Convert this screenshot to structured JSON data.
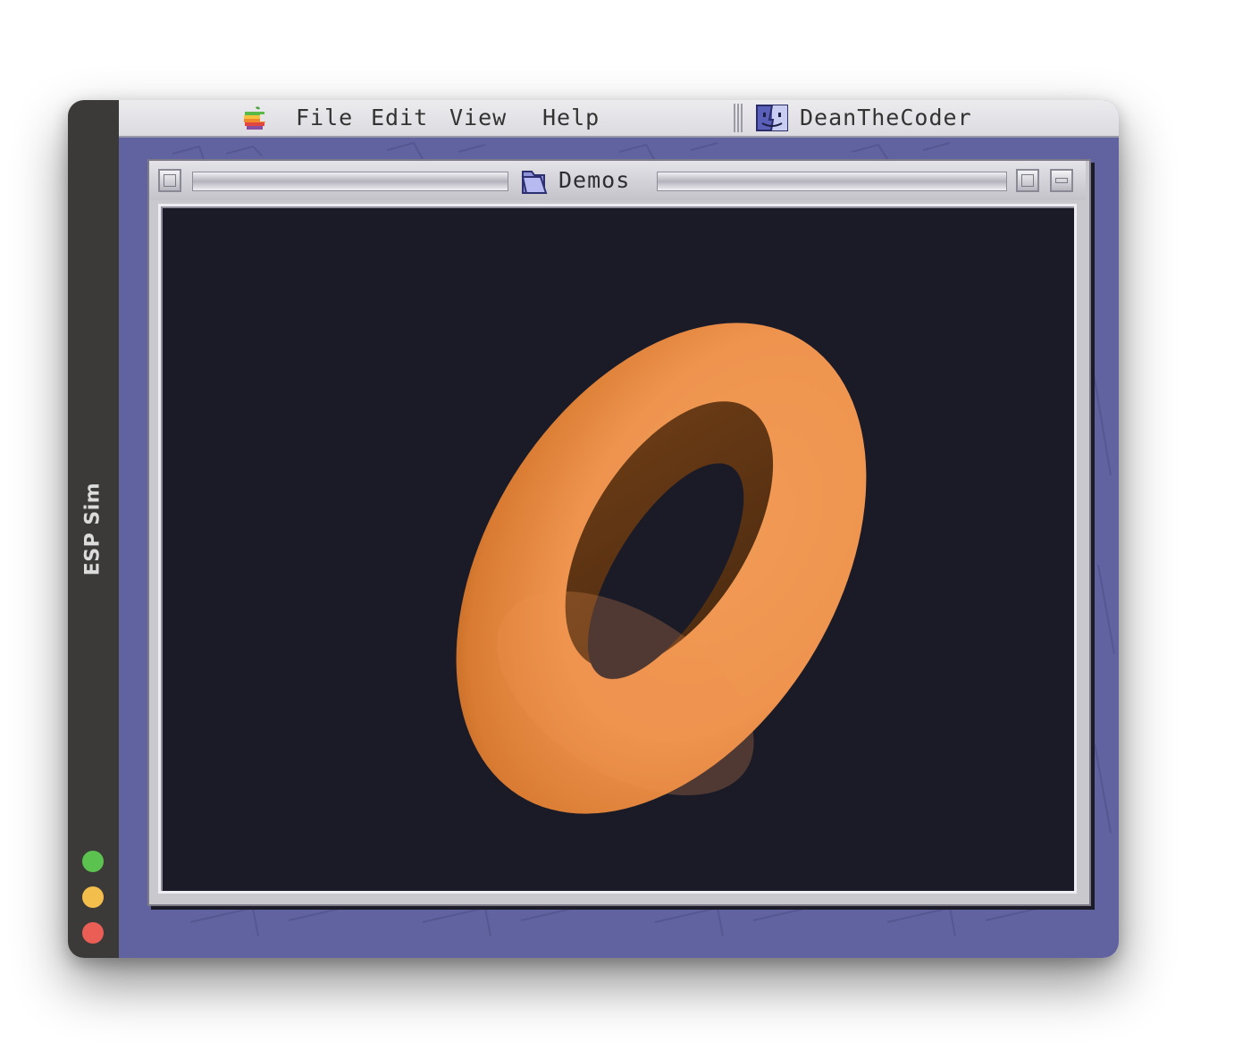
{
  "app": {
    "title": "ESP Sim",
    "traffic_lights": [
      "green",
      "yellow",
      "red"
    ]
  },
  "menubar": {
    "apple_icon": "apple-rainbow-icon",
    "items": [
      "File",
      "Edit",
      "View",
      "Help"
    ],
    "active_app": {
      "icon": "finder-face-icon",
      "label": "DeanTheCoder"
    }
  },
  "window": {
    "title": "Demos",
    "icon": "folder-icon",
    "controls": [
      "close-box",
      "zoom-box",
      "collapse-box"
    ]
  },
  "render": {
    "subject": "orange torus",
    "background_color": "#1b1b28",
    "object_color": "#ee9650",
    "shadow_color": "#5f3514"
  },
  "colors": {
    "desktop": "#6163a0",
    "sidebar": "#3b3a38",
    "menubar": "#e4e3e8"
  }
}
